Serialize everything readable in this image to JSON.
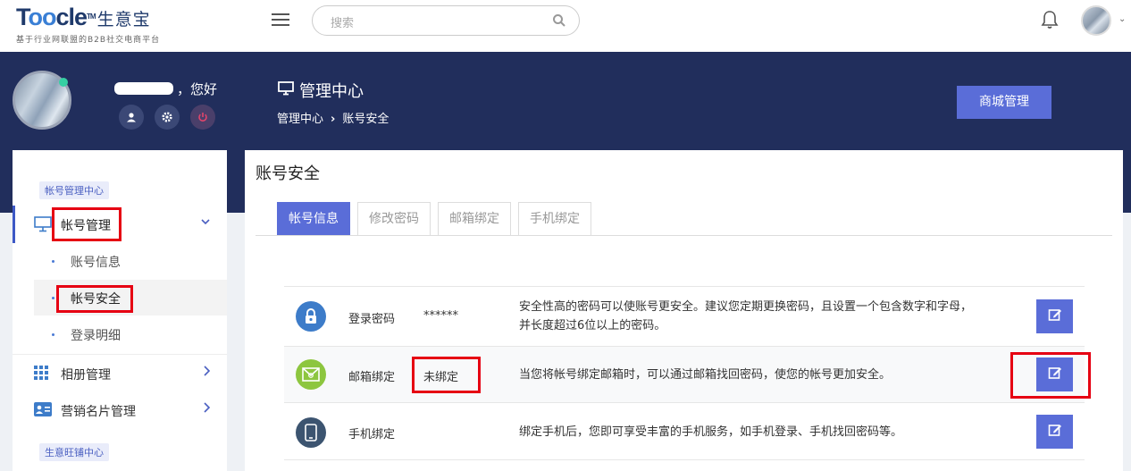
{
  "header": {
    "logo_text": "Toocle",
    "logo_tm": "TM",
    "logo_cn": "生意宝",
    "logo_tagline": "基于行业网联盟的B2B社交电商平台",
    "search_placeholder": "搜索",
    "icons": [
      "menu-icon",
      "search-icon",
      "bell-icon",
      "avatar",
      "chevron-down-icon"
    ]
  },
  "profile": {
    "greeting": "，您好",
    "actions": [
      "user-icon",
      "gear-icon",
      "power-icon"
    ],
    "status_color": "#35d0a3"
  },
  "page": {
    "title": "管理中心",
    "breadcrumb": [
      "管理中心",
      "账号安全"
    ],
    "breadcrumb_sep": "›",
    "shop_button": "商城管理"
  },
  "sidebar": {
    "section1": "帐号管理中心",
    "account_mgmt": "帐号管理",
    "sub_items": [
      "账号信息",
      "帐号安全",
      "登录明细"
    ],
    "album_mgmt": "相册管理",
    "card_mgmt": "营销名片管理",
    "section2": "生意旺铺中心"
  },
  "content": {
    "title": "账号安全",
    "tabs": [
      "帐号信息",
      "修改密码",
      "邮箱绑定",
      "手机绑定"
    ],
    "active_tab": "帐号信息",
    "rows": [
      {
        "name": "登录密码",
        "value": "******",
        "desc_line1": "安全性高的密码可以使账号更安全。建议您定期更换密码，且设置一个包含数字和字母，",
        "desc_line2": "并长度超过6位以上的密码。",
        "icon": "lock-icon",
        "icon_color": "#3d7cc9"
      },
      {
        "name": "邮箱绑定",
        "value": "未绑定",
        "desc_line1": "当您将帐号绑定邮箱时，可以通过邮箱找回密码，使您的帐号更加安全。",
        "icon": "mail-icon",
        "icon_color": "#8dc63f"
      },
      {
        "name": "手机绑定",
        "value": "",
        "desc_line1": "绑定手机后，您即可享受丰富的手机服务，如手机登录、手机找回密码等。",
        "icon": "phone-icon",
        "icon_color": "#3c5470"
      }
    ]
  },
  "colors": {
    "accent": "#5a6dd8",
    "banner": "#212e5c",
    "highlight": "#e60012"
  }
}
